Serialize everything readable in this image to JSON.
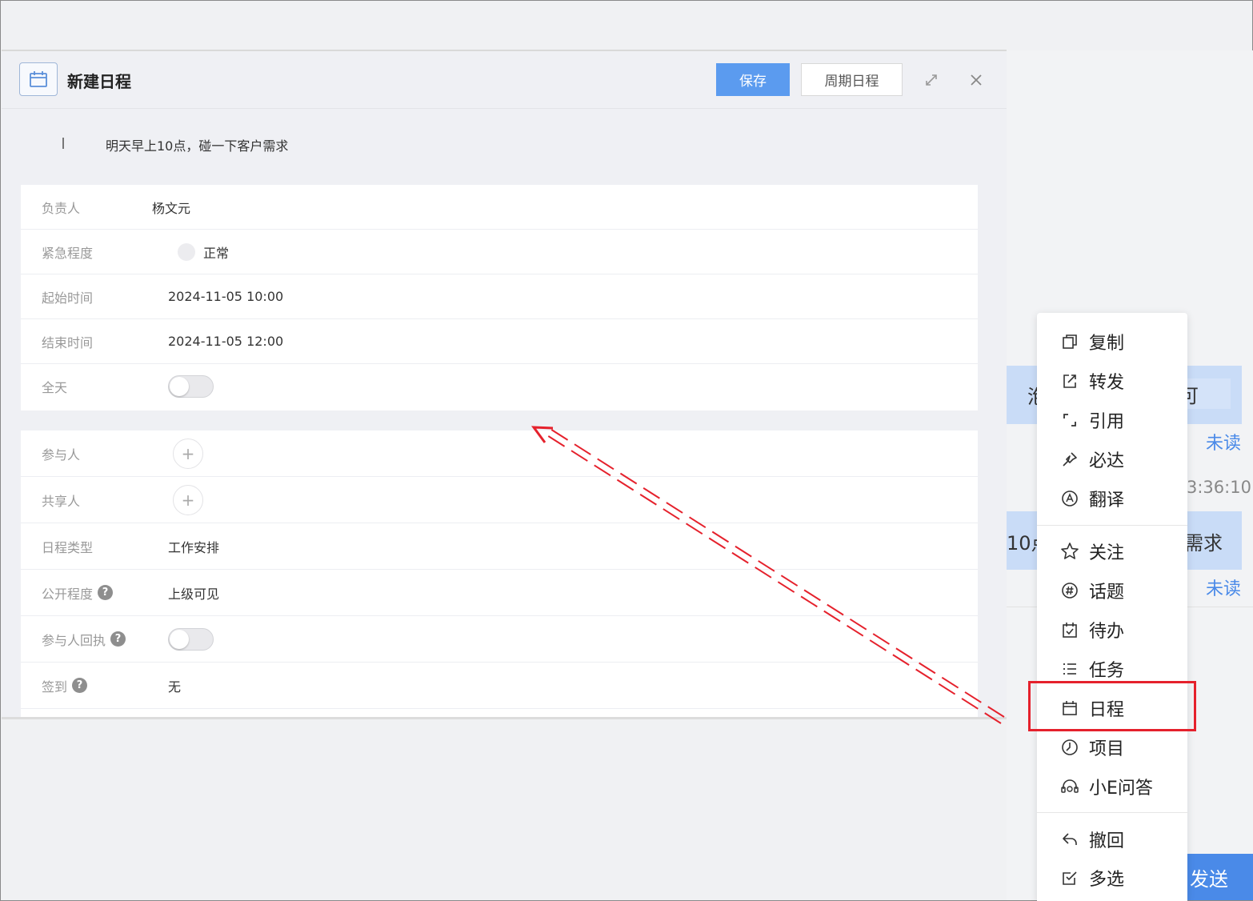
{
  "dialog": {
    "title": "新建日程",
    "save_label": "保存",
    "recurring_label": "周期日程",
    "subject": "明天早上10点，碰一下客户需求"
  },
  "form": {
    "owner": {
      "label": "负责人",
      "value": "杨文元"
    },
    "urgency": {
      "label": "紧急程度",
      "value": "正常"
    },
    "start_time": {
      "label": "起始时间",
      "value": "2024-11-05 10:00"
    },
    "end_time": {
      "label": "结束时间",
      "value": "2024-11-05 12:00"
    },
    "all_day": {
      "label": "全天",
      "value": false
    },
    "participants": {
      "label": "参与人"
    },
    "sharers": {
      "label": "共享人"
    },
    "schedule_type": {
      "label": "日程类型",
      "value": "工作安排"
    },
    "visibility": {
      "label": "公开程度",
      "value": "上级可见"
    },
    "receipt": {
      "label": "参与人回执",
      "value": false
    },
    "checkin": {
      "label": "签到",
      "value": "无"
    }
  },
  "chat": {
    "bubble1_left": "泡",
    "bubble1_right": "可",
    "bubble2_left": "10点",
    "bubble2_right": "需求",
    "unread": "未读",
    "timestamp": "3:36:10",
    "send_label": "发送"
  },
  "context_menu": {
    "items": [
      {
        "label": "复制",
        "icon": "copy-icon"
      },
      {
        "label": "转发",
        "icon": "forward-icon"
      },
      {
        "label": "引用",
        "icon": "quote-icon"
      },
      {
        "label": "必达",
        "icon": "pin-icon"
      },
      {
        "label": "翻译",
        "icon": "translate-icon"
      },
      {
        "label": "关注",
        "icon": "star-icon"
      },
      {
        "label": "话题",
        "icon": "hashtag-icon"
      },
      {
        "label": "待办",
        "icon": "todo-icon"
      },
      {
        "label": "任务",
        "icon": "task-list-icon"
      },
      {
        "label": "日程",
        "icon": "calendar-icon"
      },
      {
        "label": "项目",
        "icon": "project-icon"
      },
      {
        "label": "小E问答",
        "icon": "assistant-icon"
      },
      {
        "label": "撤回",
        "icon": "recall-icon"
      },
      {
        "label": "多选",
        "icon": "multiselect-icon"
      }
    ],
    "highlighted": "日程"
  },
  "colors": {
    "primary": "#5b9bef",
    "highlight": "#e5212c",
    "bubble": "#c9dcf7"
  }
}
